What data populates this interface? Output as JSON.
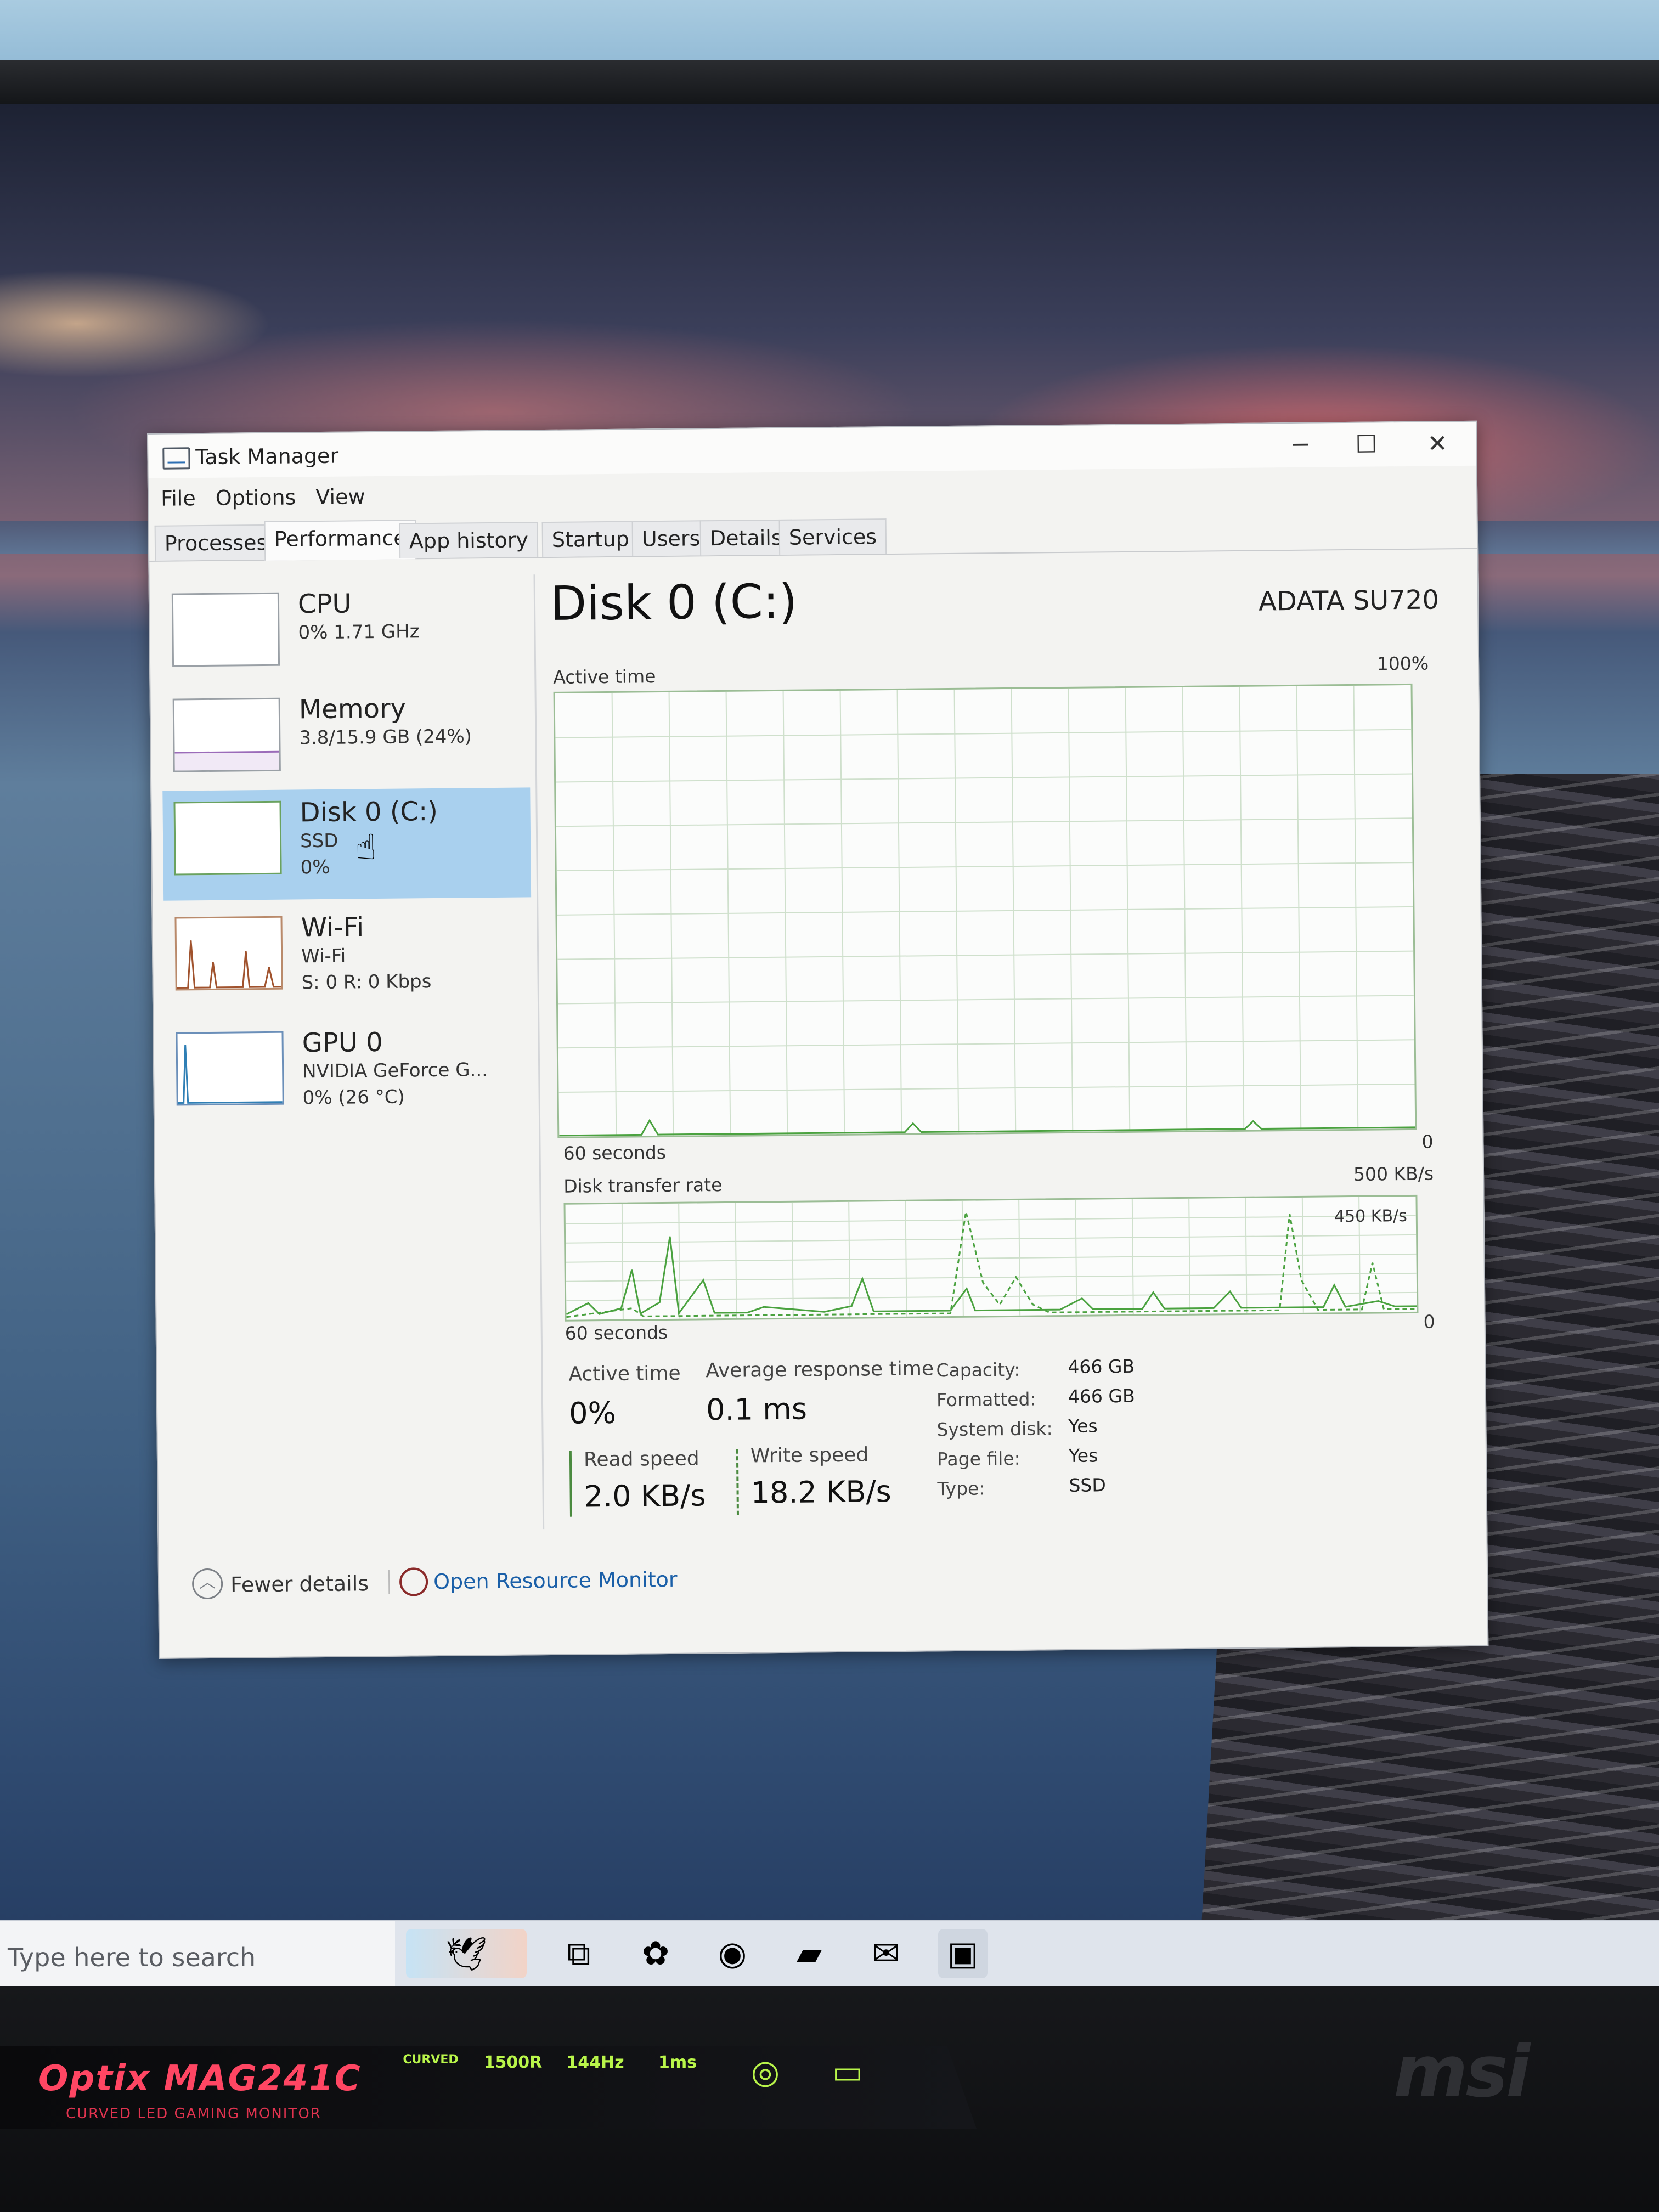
{
  "window": {
    "title": "Task Manager"
  },
  "menu": [
    "File",
    "Options",
    "View"
  ],
  "tabs": [
    "Processes",
    "Performance",
    "App history",
    "Startup",
    "Users",
    "Details",
    "Services"
  ],
  "selected_tab": "Performance",
  "sidebar": {
    "items": [
      {
        "title": "CPU",
        "line1": "0% 1.71 GHz",
        "line2": ""
      },
      {
        "title": "Memory",
        "line1": "3.8/15.9 GB (24%)",
        "line2": ""
      },
      {
        "title": "Disk 0 (C:)",
        "line1": "SSD",
        "line2": "0%"
      },
      {
        "title": "Wi-Fi",
        "line1": "Wi-Fi",
        "line2": "S: 0 R: 0 Kbps"
      },
      {
        "title": "GPU 0",
        "line1": "NVIDIA GeForce G...",
        "line2": "0% (26 °C)"
      }
    ],
    "selected_index": 2
  },
  "disk": {
    "title": "Disk 0 (C:)",
    "model": "ADATA SU720",
    "active_graph": {
      "label": "Active time",
      "max_label": "100%",
      "time_label": "60 seconds",
      "min_label": "0"
    },
    "transfer_graph": {
      "label": "Disk transfer rate",
      "max_label": "500 KB/s",
      "line_label": "450 KB/s",
      "time_label": "60 seconds",
      "min_label": "0"
    },
    "stats": {
      "active_time_label": "Active time",
      "active_time_value": "0%",
      "avg_response_label": "Average response time",
      "avg_response_value": "0.1 ms",
      "read_label": "Read speed",
      "read_value": "2.0 KB/s",
      "write_label": "Write speed",
      "write_value": "18.2 KB/s"
    },
    "properties": [
      {
        "key": "Capacity:",
        "value": "466 GB"
      },
      {
        "key": "Formatted:",
        "value": "466 GB"
      },
      {
        "key": "System disk:",
        "value": "Yes"
      },
      {
        "key": "Page file:",
        "value": "Yes"
      },
      {
        "key": "Type:",
        "value": "SSD"
      }
    ]
  },
  "footer": {
    "fewer_details": "Fewer details",
    "resource_monitor": "Open Resource Monitor"
  },
  "taskbar": {
    "search_placeholder": "Type here to search"
  },
  "monitor": {
    "model": "Optix MAG241C",
    "tagline": "CURVED LED GAMING MONITOR",
    "features": [
      "CURVED",
      "1500R",
      "144Hz",
      "1ms"
    ],
    "brand": "msi"
  },
  "colors": {
    "graph_line": "#4aa23f",
    "graph_grid": "#cfe0cc",
    "selected_item": "#a9d0ee",
    "link": "#1a5fa8"
  }
}
